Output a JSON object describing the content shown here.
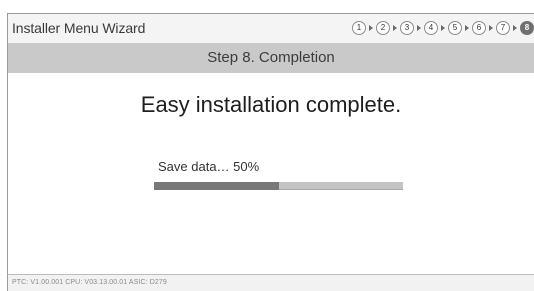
{
  "window": {
    "title": "Installer Menu Wizard"
  },
  "stepper": {
    "steps": [
      "1",
      "2",
      "3",
      "4",
      "5",
      "6",
      "7",
      "8"
    ],
    "current": "8"
  },
  "step_header": {
    "label": "Step 8. Completion"
  },
  "main": {
    "headline": "Easy installation complete.",
    "progress_label": "Save data… 50%",
    "progress_value": 0.5
  },
  "footer": {
    "version_text": "PTC:  V1.00.001 CPU: V03.13.00.01 ASIC: D279"
  },
  "colors": {
    "progress_fill": "#787878",
    "progress_track": "#c4c4c4",
    "step_header_bg": "#c9c9c9",
    "active_step": "#707070"
  }
}
